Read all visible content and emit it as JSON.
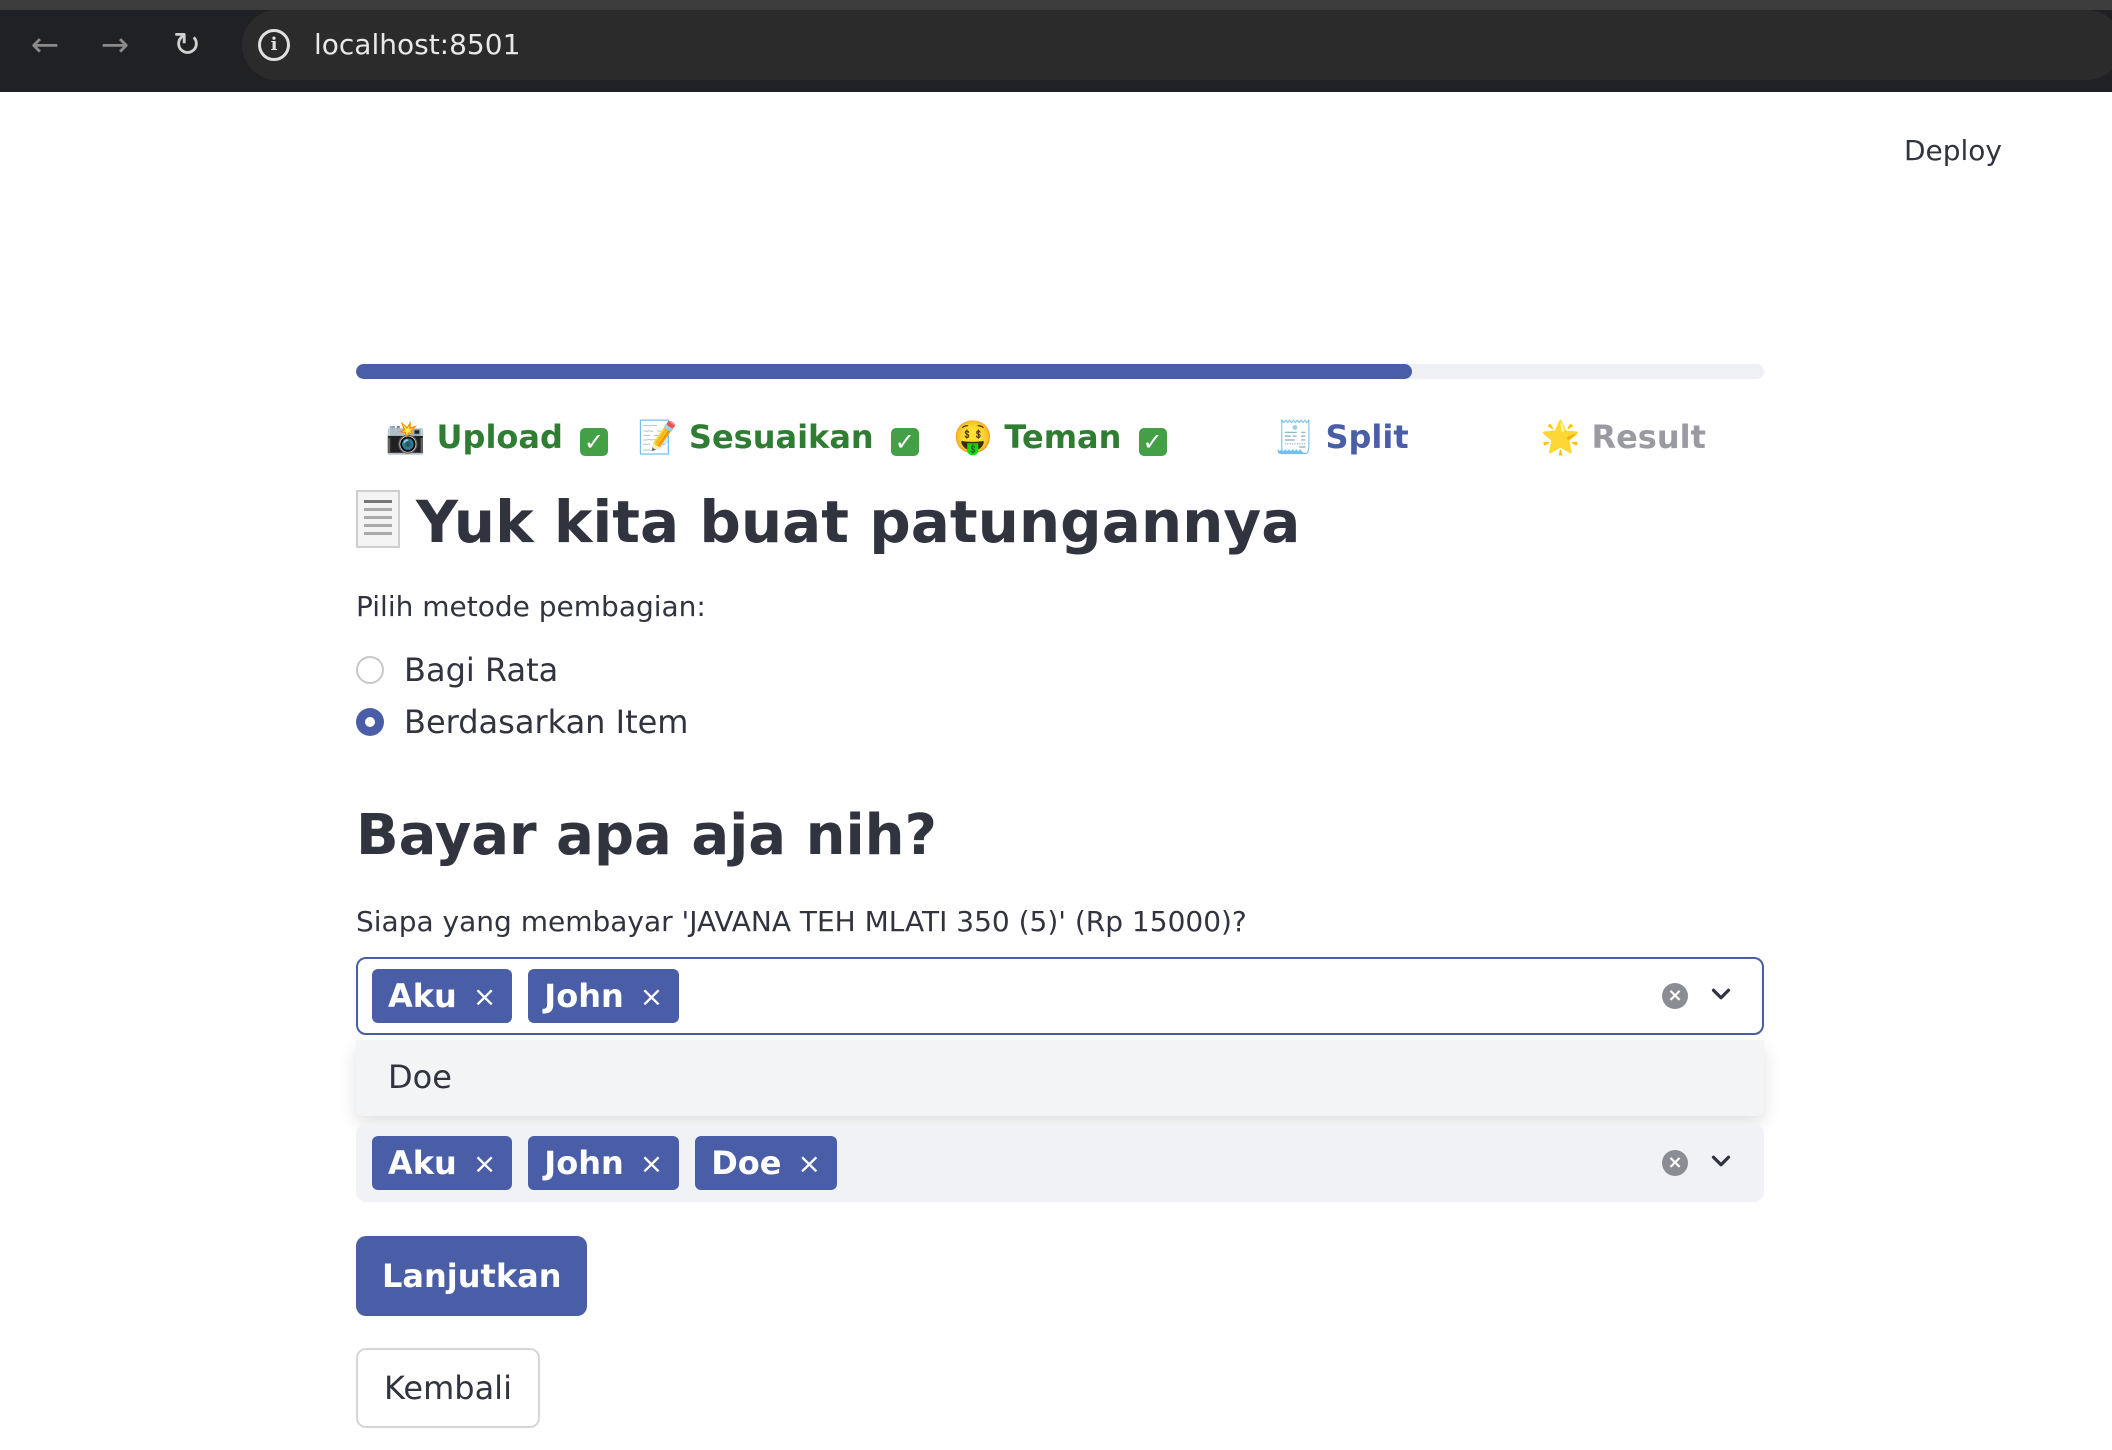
{
  "browser": {
    "url": "localhost:8501",
    "info_glyph": "i"
  },
  "header": {
    "deploy_label": "Deploy"
  },
  "progress": {
    "percent": 75
  },
  "steps": [
    {
      "emoji": "📸",
      "label": "Upload",
      "status": "done",
      "check": "✓"
    },
    {
      "emoji": "📝",
      "label": "Sesuaikan",
      "status": "done",
      "check": "✓"
    },
    {
      "emoji": "🤑",
      "label": "Teman",
      "status": "done",
      "check": "✓"
    },
    {
      "emoji": "🧾",
      "label": "Split",
      "status": "active"
    },
    {
      "emoji": "🌟",
      "label": "Result",
      "status": "pending"
    }
  ],
  "page": {
    "title": "Yuk kita buat patungannya",
    "method_label": "Pilih metode pembagian:",
    "methods": [
      {
        "label": "Bagi Rata",
        "checked": false
      },
      {
        "label": "Berdasarkan Item",
        "checked": true
      }
    ],
    "subheading": "Bayar apa aja nih?"
  },
  "items": [
    {
      "question": "Siapa yang membayar 'JAVANA TEH MLATI 350 (5)' (Rp 15000)?",
      "selected": [
        "Aku",
        "John"
      ],
      "focused": true,
      "dropdown_options": [
        "Doe"
      ]
    },
    {
      "selected": [
        "Aku",
        "John",
        "Doe"
      ],
      "focused": false
    }
  ],
  "tag_remove_glyph": "×",
  "buttons": {
    "next_label": "Lanjutkan",
    "back_label": "Kembali"
  },
  "colors": {
    "primary": "#4a5ea8",
    "done_green": "#2e7d32",
    "check_green": "#43a047"
  }
}
